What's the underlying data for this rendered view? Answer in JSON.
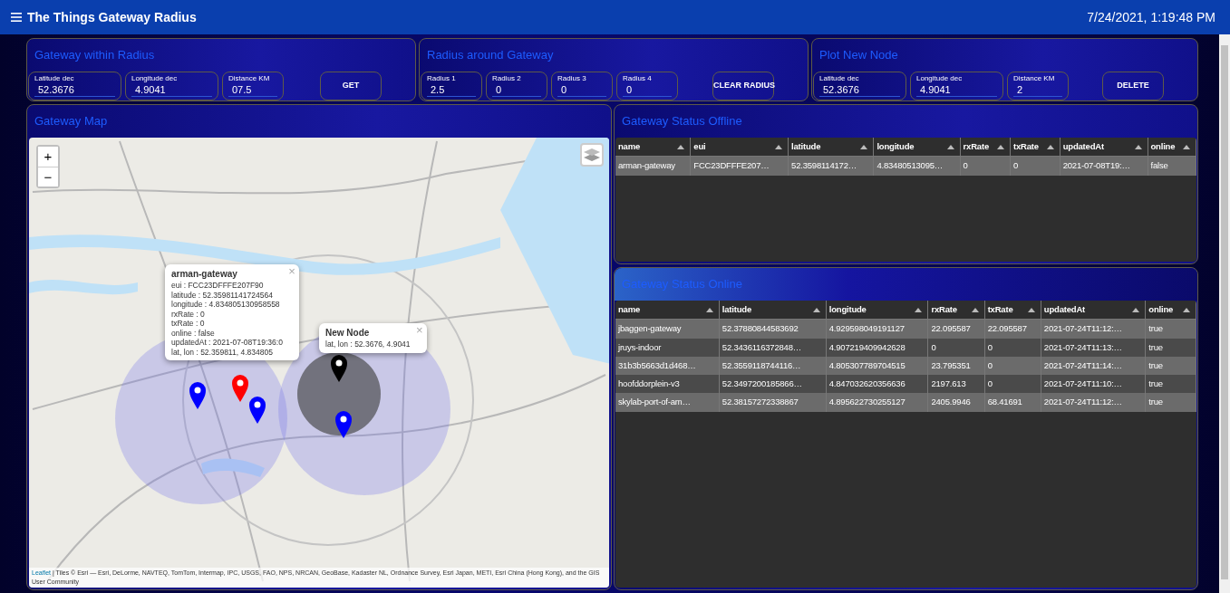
{
  "header": {
    "title": "The Things Gateway Radius",
    "datetime": "7/24/2021, 1:19:48 PM"
  },
  "top_panels": [
    {
      "title": "Gateway within Radius",
      "fields": [
        {
          "label": "Latitude dec",
          "value": "52.3676"
        },
        {
          "label": "Longitude dec",
          "value": "4.9041"
        },
        {
          "label": "Distance KM",
          "value": "07.5"
        }
      ],
      "button": "GET"
    },
    {
      "title": "Radius around Gateway",
      "fields": [
        {
          "label": "Radius 1",
          "value": "2.5"
        },
        {
          "label": "Radius 2",
          "value": "0"
        },
        {
          "label": "Radius 3",
          "value": "0"
        },
        {
          "label": "Radius 4",
          "value": "0"
        }
      ],
      "button": "CLEAR RADIUS"
    },
    {
      "title": "Plot New Node",
      "fields": [
        {
          "label": "Latitude dec",
          "value": "52.3676"
        },
        {
          "label": "Longitude dec",
          "value": "4.9041"
        },
        {
          "label": "Distance KM",
          "value": "2"
        }
      ],
      "button": "DELETE"
    }
  ],
  "map": {
    "title": "Gateway Map",
    "zoom_in": "+",
    "zoom_out": "−",
    "markers": [
      {
        "color": "#0000ff"
      },
      {
        "color": "#ff0000"
      },
      {
        "color": "#0000ff"
      },
      {
        "color": "#000000"
      },
      {
        "color": "#0000ff"
      }
    ],
    "popups": [
      {
        "title": "arman-gateway",
        "close": "×",
        "lines": [
          "eui : FCC23DFFFE207F90",
          "latitude : 52.35981141724564",
          "longitude : 4.834805130958558",
          "rxRate : 0",
          "txRate : 0",
          "online : false",
          "updatedAt : 2021-07-08T19:36:0",
          "lat, lon : 52.359811, 4.834805"
        ]
      },
      {
        "title": "New Node",
        "close": "×",
        "lines": [
          "lat, lon : 52.3676, 4.9041"
        ]
      }
    ],
    "attribution": {
      "link": "Leaflet",
      "text": "| Tiles © Esri — Esri, DeLorme, NAVTEQ, TomTom, Intermap, IPC, USGS, FAO, NPS, NRCAN, GeoBase, Kadaster NL, Ordnance Survey, Esri Japan, METI, Esri China (Hong Kong), and the GIS User Community"
    }
  },
  "tables": [
    {
      "title": "Gateway Status Offline",
      "columns": [
        "name",
        "eui",
        "latitude",
        "longitude",
        "rxRate",
        "txRate",
        "updatedAt",
        "online"
      ],
      "rows": [
        [
          "arman-gateway",
          "FCC23DFFFE207…",
          "52.3598114172…",
          "4.83480513095…",
          "0",
          "0",
          "2021-07-08T19:…",
          "false"
        ]
      ]
    },
    {
      "title": "Gateway Status Online",
      "columns": [
        "name",
        "latitude",
        "longitude",
        "rxRate",
        "txRate",
        "updatedAt",
        "online"
      ],
      "rows": [
        [
          "jbaggen-gateway",
          "52.37880844583692",
          "4.929598049191127",
          "22.095587",
          "22.095587",
          "2021-07-24T11:12:…",
          "true"
        ],
        [
          "jruys-indoor",
          "52.3436116372848…",
          "4.907219409942628",
          "0",
          "0",
          "2021-07-24T11:13:…",
          "true"
        ],
        [
          "31b3b5663d1d468…",
          "52.3559118744116…",
          "4.805307789704515",
          "23.795351",
          "0",
          "2021-07-24T11:14:…",
          "true"
        ],
        [
          "hoofddorplein-v3",
          "52.3497200185866…",
          "4.847032620356636",
          "2197.613",
          "0",
          "2021-07-24T11:10:…",
          "true"
        ],
        [
          "skylab-port-of-am…",
          "52.38157272338867",
          "4.895622730255127",
          "2405.9946",
          "68.41691",
          "2021-07-24T11:12:…",
          "true"
        ]
      ]
    }
  ]
}
